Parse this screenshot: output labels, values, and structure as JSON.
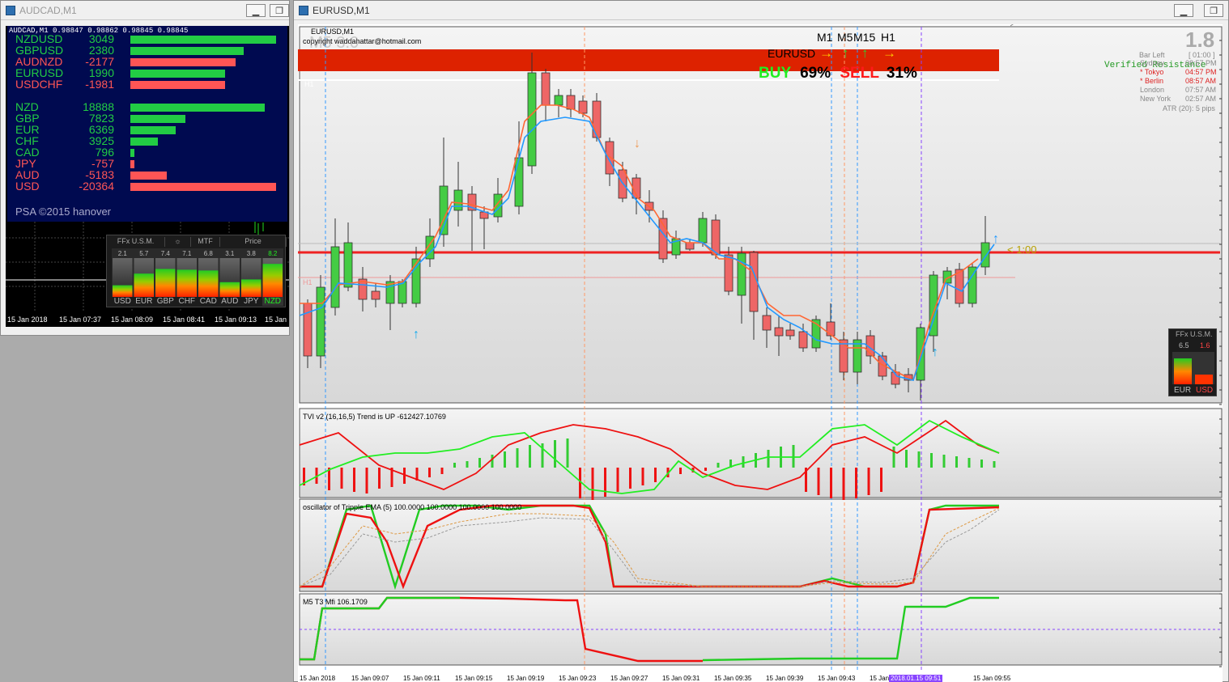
{
  "left_window": {
    "title": "AUDCAD,M1",
    "header_line": "AUDCAD,M1  0.98847 0.98862 0.98845 0.98845",
    "pairs": [
      {
        "name": "NZDUSD",
        "value": "3049",
        "color": "#22cc44",
        "strength": 1.0
      },
      {
        "name": "GBPUSD",
        "value": "2380",
        "color": "#22cc44",
        "strength": 0.78
      },
      {
        "name": "AUDNZD",
        "value": "-2177",
        "color": "#ff5555",
        "strength": 0.72
      },
      {
        "name": "EURUSD",
        "value": "1990",
        "color": "#22cc44",
        "strength": 0.65
      },
      {
        "name": "USDCHF",
        "value": "-1981",
        "color": "#ff5555",
        "strength": 0.65
      }
    ],
    "currencies": [
      {
        "name": "NZD",
        "value": "18888",
        "color": "#22cc44",
        "strength": 0.92
      },
      {
        "name": "GBP",
        "value": "7823",
        "color": "#22cc44",
        "strength": 0.38
      },
      {
        "name": "EUR",
        "value": "6369",
        "color": "#22cc44",
        "strength": 0.31
      },
      {
        "name": "CHF",
        "value": "3925",
        "color": "#22cc44",
        "strength": 0.19
      },
      {
        "name": "CAD",
        "value": "796",
        "color": "#22cc44",
        "strength": 0.03
      },
      {
        "name": "JPY",
        "value": "-757",
        "color": "#ff5555",
        "strength": 0.03
      },
      {
        "name": "AUD",
        "value": "-5183",
        "color": "#ff5555",
        "strength": 0.25
      },
      {
        "name": "USD",
        "value": "-20364",
        "color": "#ff5555",
        "strength": 1.0
      }
    ],
    "credit": "PSA ©2015 hanover",
    "usm_header": [
      "FFx U.S.M.",
      "MTF",
      "Price"
    ],
    "usm_values": [
      "2.1",
      "5.7",
      "7.4",
      "7.1",
      "6.8",
      "3.1",
      "3.8",
      "8.2"
    ],
    "usm_levels": [
      0.3,
      0.6,
      0.72,
      0.7,
      0.68,
      0.38,
      0.45,
      0.85
    ],
    "usm_labels": [
      "USD",
      "EUR",
      "GBP",
      "CHF",
      "CAD",
      "AUD",
      "JPY",
      "NZD"
    ],
    "time_axis": [
      "15 Jan 2018",
      "15 Jan 07:37",
      "15 Jan 08:09",
      "15 Jan 08:41",
      "15 Jan 09:13",
      "15 Jan"
    ]
  },
  "main_window": {
    "title": "EURUSD,M1",
    "chart_label": "EURUSD,M1",
    "copyright": "copyright waddahattar@hotmail.com",
    "watermark": "M5 3.0",
    "h1_marker": "H1",
    "timeframes": [
      "M1",
      "M5",
      "M15",
      "H1"
    ],
    "symbol": "EURUSD",
    "buy_label": "BUY",
    "buy_pct": "69%",
    "sell_label": "SELL",
    "sell_pct": "31%",
    "spread_value": "1.8",
    "bar_left_label": "Bar Left",
    "bar_left_value": "[ 01:00 ]",
    "verified": "Verified Resistance",
    "sessions": [
      {
        "city": "Sydney",
        "time": "08:57 PM",
        "color": "#888888"
      },
      {
        "city": "* Tokyo",
        "time": "04:57 PM",
        "color": "#dd2222"
      },
      {
        "city": "* Berlin",
        "time": "08:57 AM",
        "color": "#dd2222"
      },
      {
        "city": "London",
        "time": "07:57 AM",
        "color": "#888888"
      },
      {
        "city": "New York",
        "time": "02:57 AM",
        "color": "#888888"
      }
    ],
    "atr": "ATR (20): 5 pips",
    "countdown": "< 1:00",
    "mini_usm": {
      "title": "FFx U.S.M.",
      "values": [
        "6.5",
        "1.6"
      ],
      "labels": [
        "EUR",
        "USD"
      ]
    },
    "tvi_label": "TVI v2 (16,16,5) Trend is UP -612427.10769",
    "osc_label": "oscillator of Tripple EMA (5) 100.0000 100.0000 100.0000 100.0000",
    "mfi_label": "M5  T3 Mfi  106.1709",
    "time_axis": [
      "15 Jan 2018",
      "15 Jan 09:07",
      "15 Jan 09:11",
      "15 Jan 09:15",
      "15 Jan 09:19",
      "15 Jan 09:23",
      "15 Jan 09:27",
      "15 Jan 09:31",
      "15 Jan 09:35",
      "15 Jan 09:39",
      "15 Jan 09:43",
      "15 Jan",
      "2018.01.15 09:51",
      "15 Jan 09:55"
    ]
  }
}
